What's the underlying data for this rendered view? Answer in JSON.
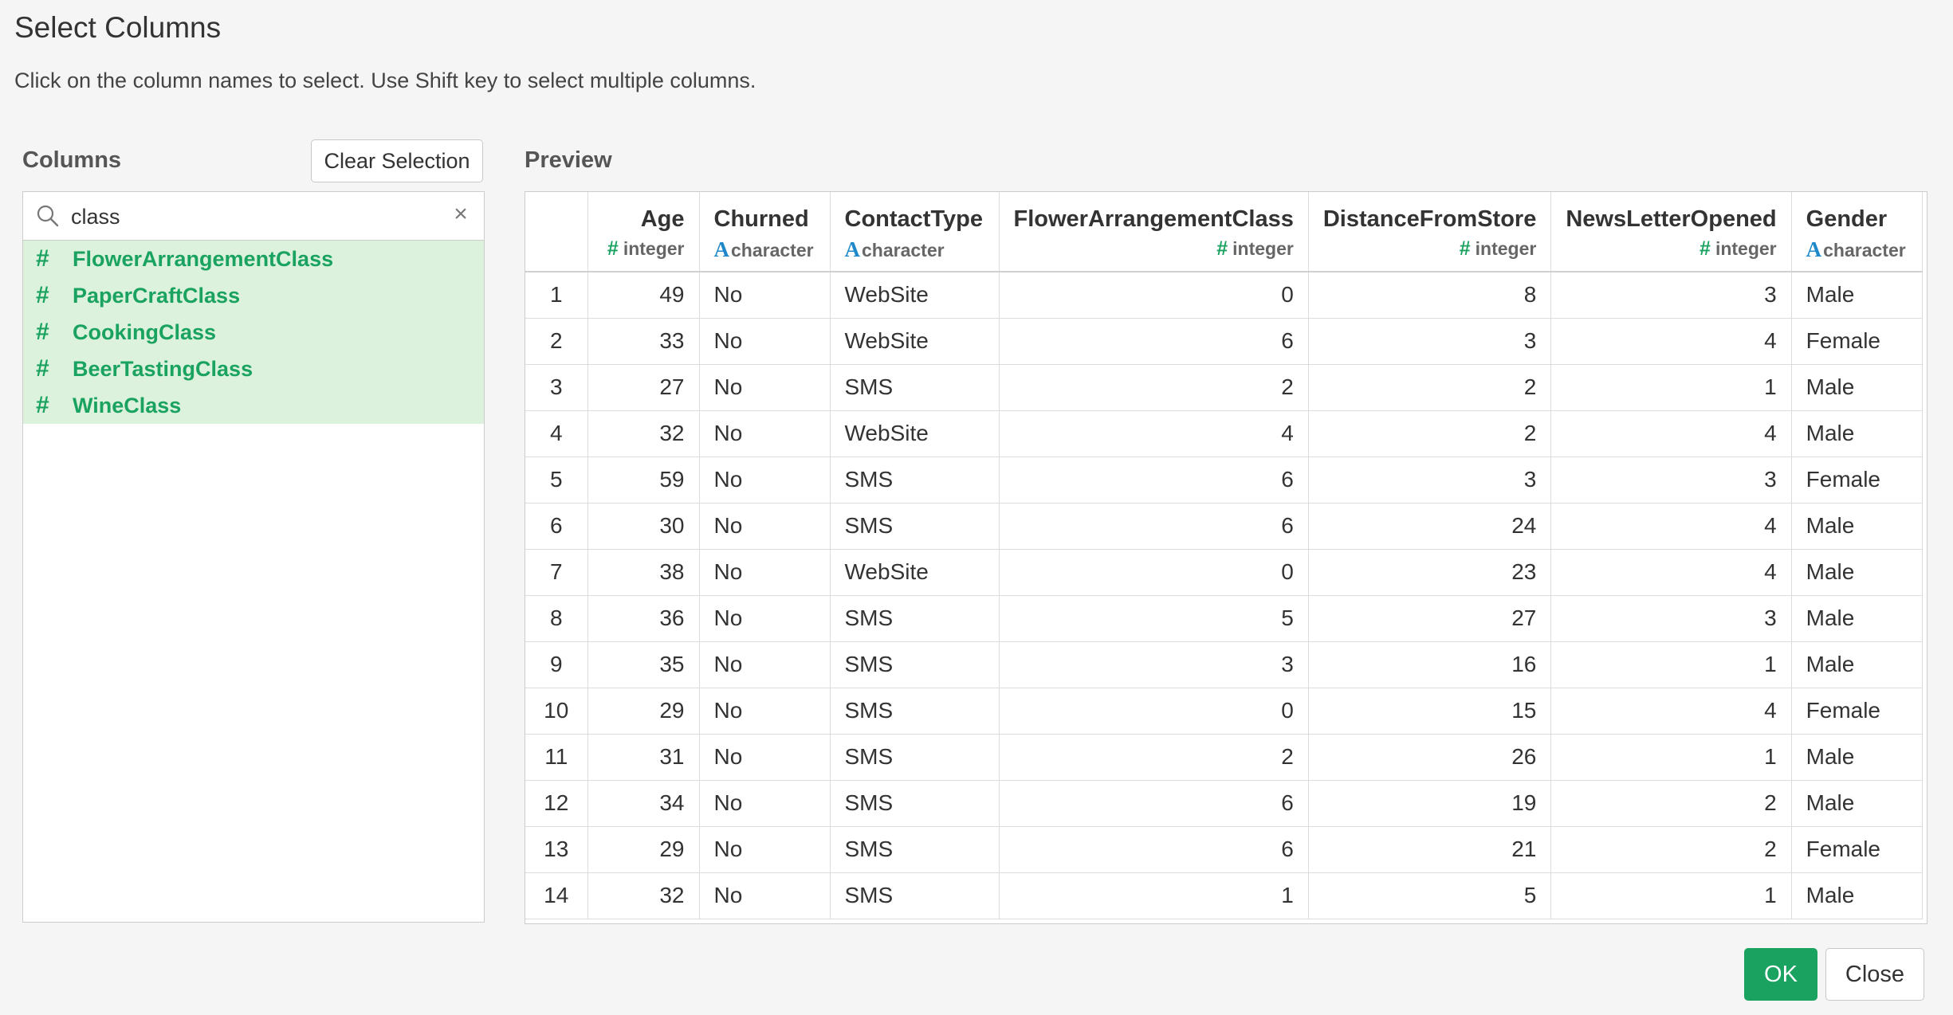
{
  "dialog": {
    "title": "Select Columns",
    "subtitle": "Click on the column names to select. Use Shift key to select multiple columns."
  },
  "columns_panel": {
    "label": "Columns",
    "clear_button": "Clear Selection",
    "search_value": "class",
    "clear_icon": "close-icon",
    "items": [
      {
        "type_icon": "#",
        "name": "FlowerArrangementClass"
      },
      {
        "type_icon": "#",
        "name": "PaperCraftClass"
      },
      {
        "type_icon": "#",
        "name": "CookingClass"
      },
      {
        "type_icon": "#",
        "name": "BeerTastingClass"
      },
      {
        "type_icon": "#",
        "name": "WineClass"
      }
    ]
  },
  "preview": {
    "label": "Preview",
    "columns": [
      {
        "name": "Age",
        "type": "integer",
        "icon": "#"
      },
      {
        "name": "Churned",
        "type": "character",
        "icon": "A"
      },
      {
        "name": "ContactType",
        "type": "character",
        "icon": "A"
      },
      {
        "name": "FlowerArrangementClass",
        "type": "integer",
        "icon": "#"
      },
      {
        "name": "DistanceFromStore",
        "type": "integer",
        "icon": "#"
      },
      {
        "name": "NewsLetterOpened",
        "type": "integer",
        "icon": "#"
      },
      {
        "name": "Gender",
        "type": "character",
        "icon": "A"
      }
    ],
    "rows": [
      [
        "1",
        "49",
        "No",
        "WebSite",
        "0",
        "8",
        "3",
        "Male"
      ],
      [
        "2",
        "33",
        "No",
        "WebSite",
        "6",
        "3",
        "4",
        "Female"
      ],
      [
        "3",
        "27",
        "No",
        "SMS",
        "2",
        "2",
        "1",
        "Male"
      ],
      [
        "4",
        "32",
        "No",
        "WebSite",
        "4",
        "2",
        "4",
        "Male"
      ],
      [
        "5",
        "59",
        "No",
        "SMS",
        "6",
        "3",
        "3",
        "Female"
      ],
      [
        "6",
        "30",
        "No",
        "SMS",
        "6",
        "24",
        "4",
        "Male"
      ],
      [
        "7",
        "38",
        "No",
        "WebSite",
        "0",
        "23",
        "4",
        "Male"
      ],
      [
        "8",
        "36",
        "No",
        "SMS",
        "5",
        "27",
        "3",
        "Male"
      ],
      [
        "9",
        "35",
        "No",
        "SMS",
        "3",
        "16",
        "1",
        "Male"
      ],
      [
        "10",
        "29",
        "No",
        "SMS",
        "0",
        "15",
        "4",
        "Female"
      ],
      [
        "11",
        "31",
        "No",
        "SMS",
        "2",
        "26",
        "1",
        "Male"
      ],
      [
        "12",
        "34",
        "No",
        "SMS",
        "6",
        "19",
        "2",
        "Male"
      ],
      [
        "13",
        "29",
        "No",
        "SMS",
        "6",
        "21",
        "2",
        "Female"
      ],
      [
        "14",
        "32",
        "No",
        "SMS",
        "1",
        "5",
        "1",
        "Male"
      ]
    ]
  },
  "footer": {
    "ok_label": "OK",
    "close_label": "Close"
  },
  "colors": {
    "accent": "#1aa260",
    "selected_bg": "#dcf2dc",
    "char_icon": "#1e88c8"
  }
}
